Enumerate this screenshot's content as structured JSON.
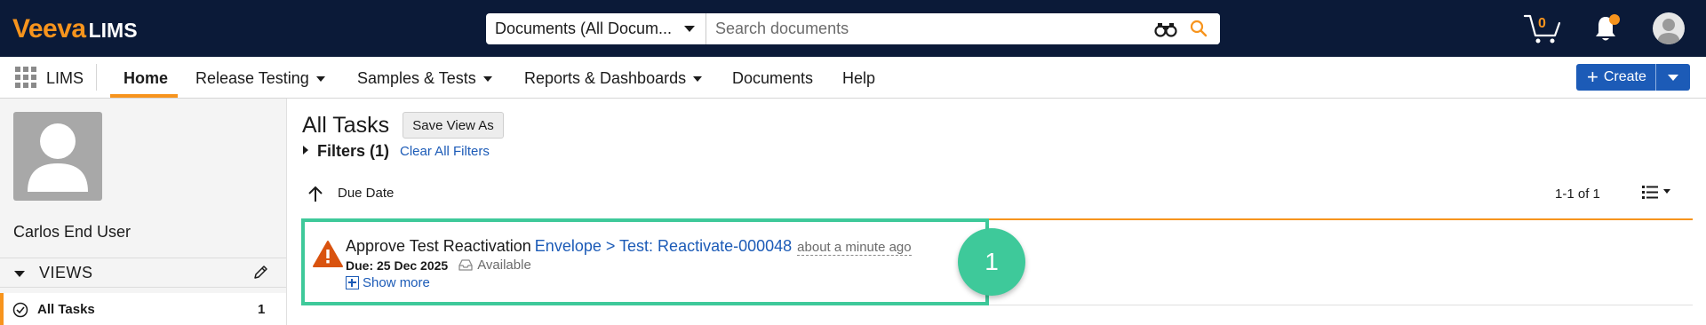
{
  "app": {
    "logo_veeva": "Veeva",
    "logo_product": "LIMS"
  },
  "search": {
    "scope": "Documents (All Docum...",
    "placeholder": "Search documents"
  },
  "header": {
    "cart_count": "0"
  },
  "nav": {
    "app_name": "LIMS",
    "items": [
      {
        "label": "Home",
        "active": true
      },
      {
        "label": "Release Testing",
        "dropdown": true
      },
      {
        "label": "Samples & Tests",
        "dropdown": true
      },
      {
        "label": "Reports & Dashboards",
        "dropdown": true
      },
      {
        "label": "Documents"
      },
      {
        "label": "Help"
      }
    ],
    "create_label": "Create"
  },
  "sidebar": {
    "user_name": "Carlos End User",
    "views_label": "VIEWS",
    "views": [
      {
        "label": "All Tasks",
        "count": "1"
      }
    ]
  },
  "main": {
    "title": "All Tasks",
    "save_view_label": "Save View As",
    "filters_label": "Filters (1)",
    "clear_filters_label": "Clear All Filters",
    "sort_label": "Due Date",
    "count_label": "1-1 of 1",
    "tasks": [
      {
        "title": "Approve Test Reactivation",
        "link": "Envelope > Test: Reactivate-000048",
        "time": "about a minute ago",
        "due": "Due: 25 Dec 2025",
        "status": "Available",
        "show_more": "Show more"
      }
    ]
  },
  "annotation": {
    "badge": "1"
  },
  "colors": {
    "topbar": "#0b1a38",
    "brand_orange": "#f7941d",
    "link_blue": "#1c5bb7",
    "highlight_green": "#3ec99a",
    "warning": "#d9530f"
  }
}
